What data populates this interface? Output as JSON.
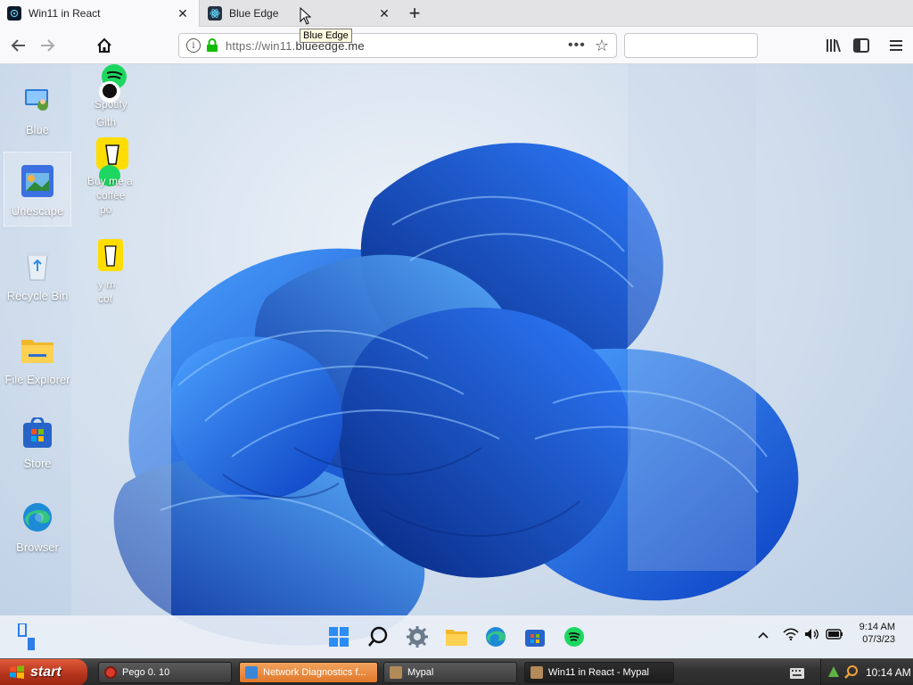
{
  "browser": {
    "tabs": [
      {
        "title": "Win11 in React",
        "active": true
      },
      {
        "title": "Blue Edge",
        "active": false
      }
    ],
    "tooltip": "Blue Edge",
    "url_prefix": "https://win11.",
    "url_domain": "blueedge.me"
  },
  "desktop": {
    "icons": [
      {
        "label": "Blue",
        "icon": "blue-user-icon"
      },
      {
        "label": "Unescape",
        "icon": "unescape-icon"
      },
      {
        "label": "Recycle Bin",
        "icon": "recycle-bin-icon"
      },
      {
        "label": "File Explorer",
        "icon": "folder-icon"
      },
      {
        "label": "Store",
        "icon": "store-icon"
      },
      {
        "label": "Browser",
        "icon": "edge-icon"
      }
    ],
    "glitch_labels": [
      "Spotify",
      "Gith",
      "Buy me a",
      "coffee",
      "po",
      "y m",
      "cof"
    ]
  },
  "w11_taskbar": {
    "apps": [
      "windows-start-icon",
      "search-icon",
      "settings-icon",
      "file-explorer-icon",
      "edge-icon",
      "store-icon",
      "spotify-icon"
    ],
    "clock_time": "9:14 AM",
    "clock_date": "07/3/23"
  },
  "xp_taskbar": {
    "start_label": "start",
    "tasks": [
      {
        "label": "Pego 0. 10"
      },
      {
        "label": "Network Diagnostics f..."
      },
      {
        "label": "Mypal"
      },
      {
        "label": "Win11 in React - Mypal"
      }
    ],
    "time": "10:14 AM"
  },
  "colors": {
    "accent": "#1a6df0",
    "xp_start": "#b2321a"
  }
}
